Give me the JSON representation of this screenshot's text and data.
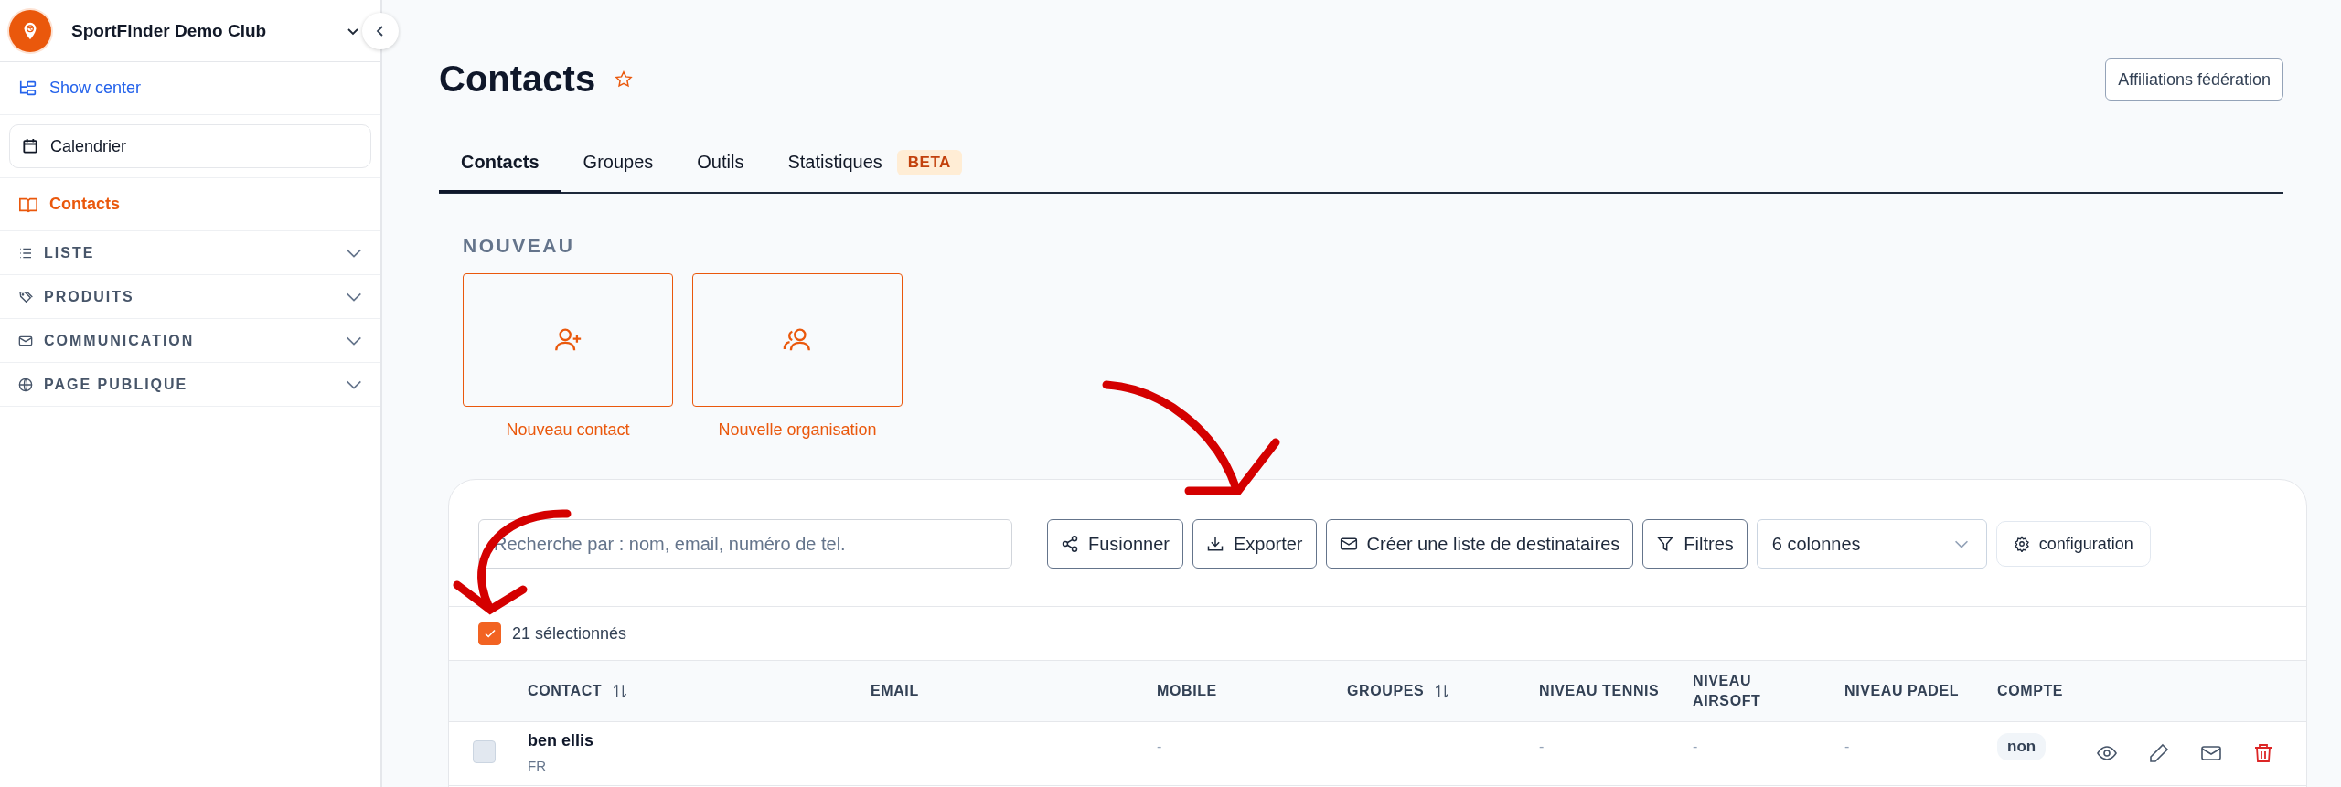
{
  "sidebar": {
    "club_name": "SportFinder Demo Club",
    "items": [
      {
        "label": "Show center",
        "kind": "external"
      },
      {
        "label": "Calendrier",
        "kind": "card"
      },
      {
        "label": "Contacts",
        "kind": "page",
        "selected": true
      },
      {
        "label": "LISTE",
        "kind": "section",
        "expanded": false
      },
      {
        "label": "PRODUITS",
        "kind": "section",
        "expanded": false
      },
      {
        "label": "COMMUNICATION",
        "kind": "section",
        "expanded": false
      },
      {
        "label": "PAGE PUBLIQUE",
        "kind": "section",
        "expanded": false
      }
    ]
  },
  "header": {
    "title": "Contacts",
    "favorite": false,
    "action": "Affiliations fédération"
  },
  "tabs": [
    {
      "label": "Contacts",
      "selected": true
    },
    {
      "label": "Groupes",
      "selected": false
    },
    {
      "label": "Outils",
      "selected": false
    },
    {
      "label": "Statistiques",
      "selected": false,
      "badge": "BETA"
    }
  ],
  "new_section": {
    "title": "NOUVEAU",
    "cards": [
      {
        "label": "Nouveau contact"
      },
      {
        "label": "Nouvelle organisation"
      }
    ]
  },
  "toolbar": {
    "search": {
      "placeholder": "Recherche par : nom, email, numéro de tel."
    },
    "buttons": [
      {
        "label": "Fusionner"
      },
      {
        "label": "Exporter"
      },
      {
        "label": "Créer une liste de destinataires"
      },
      {
        "label": "Filtres"
      }
    ],
    "columns_select": "6 colonnes",
    "config": "configuration"
  },
  "selection": {
    "checked": true,
    "label": "21 sélectionnés"
  },
  "table": {
    "columns": [
      {
        "label": "CONTACT",
        "sortable": true
      },
      {
        "label": "EMAIL",
        "sortable": false
      },
      {
        "label": "MOBILE",
        "sortable": false
      },
      {
        "label": "GROUPES",
        "sortable": true
      },
      {
        "label": "NIVEAU TENNIS",
        "sortable": false
      },
      {
        "label": "NIVEAU AIRSOFT",
        "sortable": false
      },
      {
        "label": "NIVEAU PADEL",
        "sortable": false
      },
      {
        "label": "COMPTE",
        "sortable": false
      }
    ],
    "rows": [
      {
        "selected": false,
        "name": "ben ellis",
        "country": "FR",
        "mobile": "-",
        "tennis": "-",
        "airsoft": "-",
        "padel": "-",
        "account": "non"
      }
    ]
  }
}
